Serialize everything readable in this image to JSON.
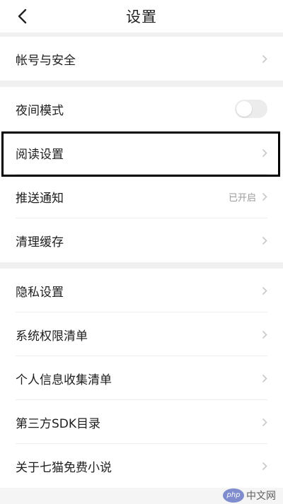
{
  "header": {
    "title": "设置"
  },
  "sections": [
    {
      "items": [
        {
          "label": "帐号与安全"
        }
      ]
    },
    {
      "items": [
        {
          "label": "夜间模式"
        },
        {
          "label": "阅读设置"
        },
        {
          "label": "推送通知",
          "value": "已开启"
        },
        {
          "label": "清理缓存"
        }
      ]
    },
    {
      "items": [
        {
          "label": "隐私设置"
        },
        {
          "label": "系统权限清单"
        },
        {
          "label": "个人信息收集清单"
        },
        {
          "label": "第三方SDK目录"
        },
        {
          "label": "关于七猫免费小说"
        }
      ]
    }
  ],
  "night_mode_enabled": false,
  "watermark": {
    "badge": "php",
    "text": "中文网"
  },
  "colors": {
    "highlight_border": "#000000",
    "chevron": "#c8c8c8"
  }
}
